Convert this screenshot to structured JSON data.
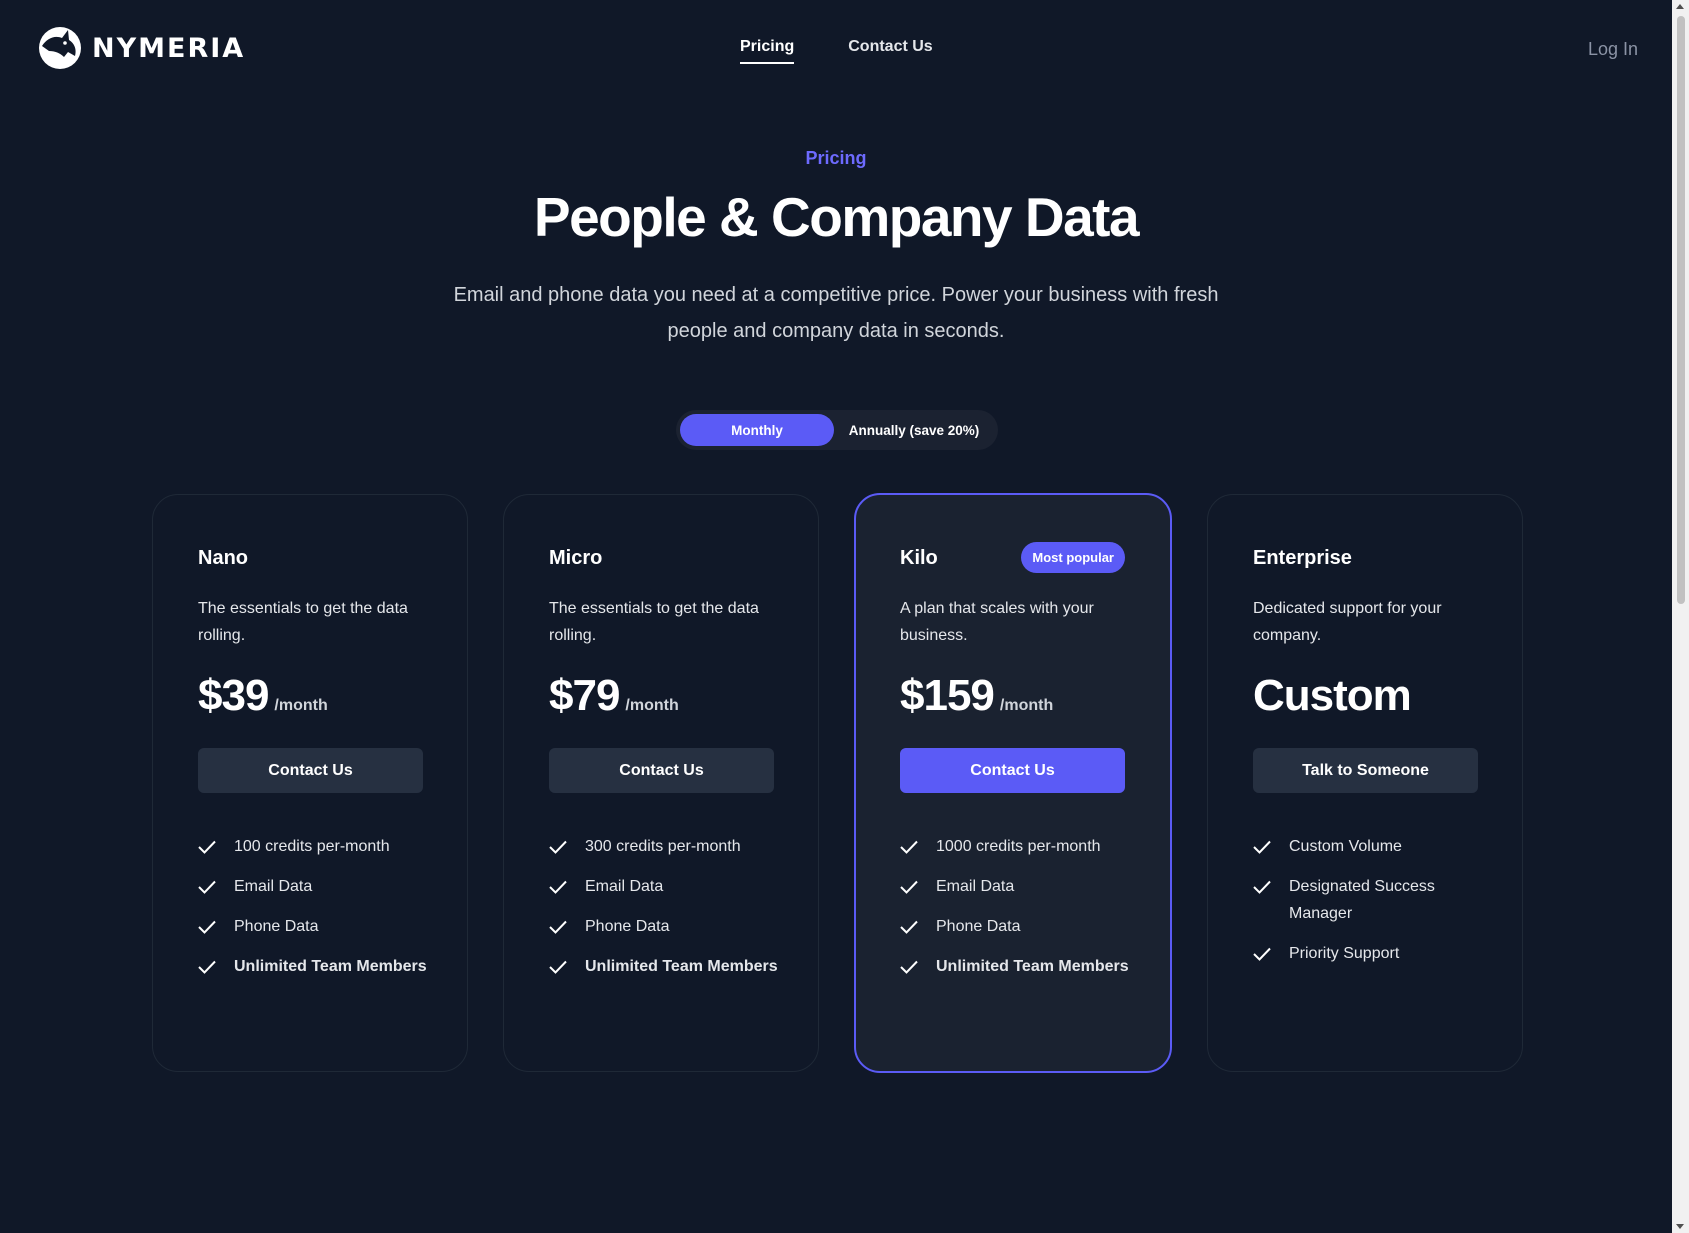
{
  "brand": {
    "name": "NYMERIA",
    "logo_icon": "wolf-head-icon"
  },
  "nav": {
    "items": [
      {
        "label": "Pricing",
        "active": true
      },
      {
        "label": "Contact Us",
        "active": false
      }
    ],
    "login_label": "Log In"
  },
  "hero": {
    "eyebrow": "Pricing",
    "title": "People & Company Data",
    "subtitle": "Email and phone data you need at a competitive price. Power your business with fresh people and company data in seconds."
  },
  "billing_toggle": {
    "options": [
      "Monthly",
      "Annually (save 20%)"
    ],
    "selected": "Monthly"
  },
  "colors": {
    "background": "#101828",
    "accent": "#5b5bf6",
    "eyebrow": "#6d6afe",
    "button_secondary": "#263041"
  },
  "plans": [
    {
      "name": "Nano",
      "description": "The essentials to get the data rolling.",
      "price": "$39",
      "per": "/month",
      "button": "Contact Us",
      "featured": false,
      "features": [
        {
          "text": "100 credits per-month",
          "bold": false
        },
        {
          "text": "Email Data",
          "bold": false
        },
        {
          "text": "Phone Data",
          "bold": false
        },
        {
          "text": "Unlimited Team Members",
          "bold": true
        }
      ]
    },
    {
      "name": "Micro",
      "description": "The essentials to get the data rolling.",
      "price": "$79",
      "per": "/month",
      "button": "Contact Us",
      "featured": false,
      "features": [
        {
          "text": "300 credits per-month",
          "bold": false
        },
        {
          "text": "Email Data",
          "bold": false
        },
        {
          "text": "Phone Data",
          "bold": false
        },
        {
          "text": "Unlimited Team Members",
          "bold": true
        }
      ]
    },
    {
      "name": "Kilo",
      "badge": "Most popular",
      "description": "A plan that scales with your business.",
      "price": "$159",
      "per": "/month",
      "button": "Contact Us",
      "featured": true,
      "features": [
        {
          "text": "1000 credits per-month",
          "bold": false
        },
        {
          "text": "Email Data",
          "bold": false
        },
        {
          "text": "Phone Data",
          "bold": false
        },
        {
          "text": "Unlimited Team Members",
          "bold": true
        }
      ]
    },
    {
      "name": "Enterprise",
      "description": "Dedicated support for your company.",
      "price": "Custom",
      "per": "",
      "button": "Talk to Someone",
      "featured": false,
      "features": [
        {
          "text": "Custom Volume",
          "bold": false
        },
        {
          "text": "Designated Success Manager",
          "bold": false
        },
        {
          "text": "Priority Support",
          "bold": false
        }
      ]
    }
  ]
}
